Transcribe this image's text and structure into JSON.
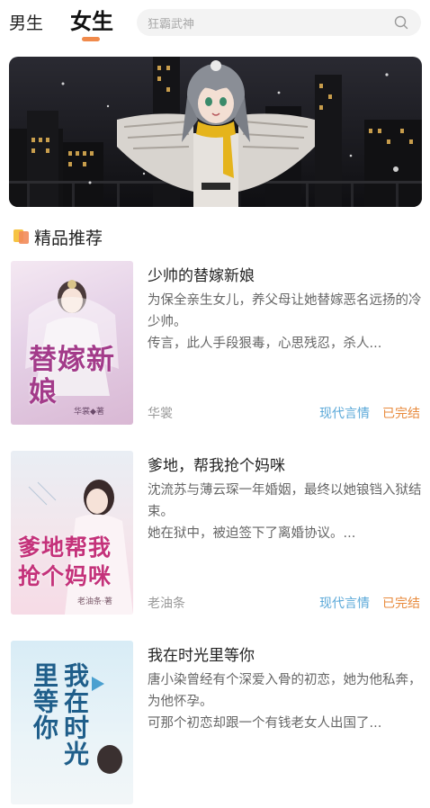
{
  "tabs": {
    "male": "男生",
    "female": "女生"
  },
  "search": {
    "placeholder": "狂霸武神"
  },
  "section": {
    "title": "精品推荐"
  },
  "books": [
    {
      "title": "少帅的替嫁新娘",
      "desc1": "为保全亲生女儿，养父母让她替嫁恶名远扬的冷少帅。",
      "desc2": "传言，此人手段狠毒，心思残忍，杀人...",
      "author": "华裳",
      "genre": "现代言情",
      "status": "已完结",
      "cover_text": "替嫁新娘",
      "cover_author": "华裳◆著"
    },
    {
      "title": "爹地，帮我抢个妈咪",
      "desc1": "沈流苏与薄云琛一年婚姻，最终以她锒铛入狱结束。",
      "desc2": "她在狱中，被迫签下了离婚协议。...",
      "author": "老油条",
      "genre": "现代言情",
      "status": "已完结",
      "cover_text": "爹地帮我抢个妈咪",
      "cover_author": "老油条·著"
    },
    {
      "title": "我在时光里等你",
      "desc1": "唐小染曾经有个深爱入骨的初恋，她为他私奔，为他怀孕。",
      "desc2": "可那个初恋却跟一个有钱老女人出国了...",
      "cover_text": "我在时光里等你"
    }
  ],
  "colors": {
    "accent": "#f08a4b",
    "genre": "#5aa8d8",
    "status": "#e88a3c"
  }
}
